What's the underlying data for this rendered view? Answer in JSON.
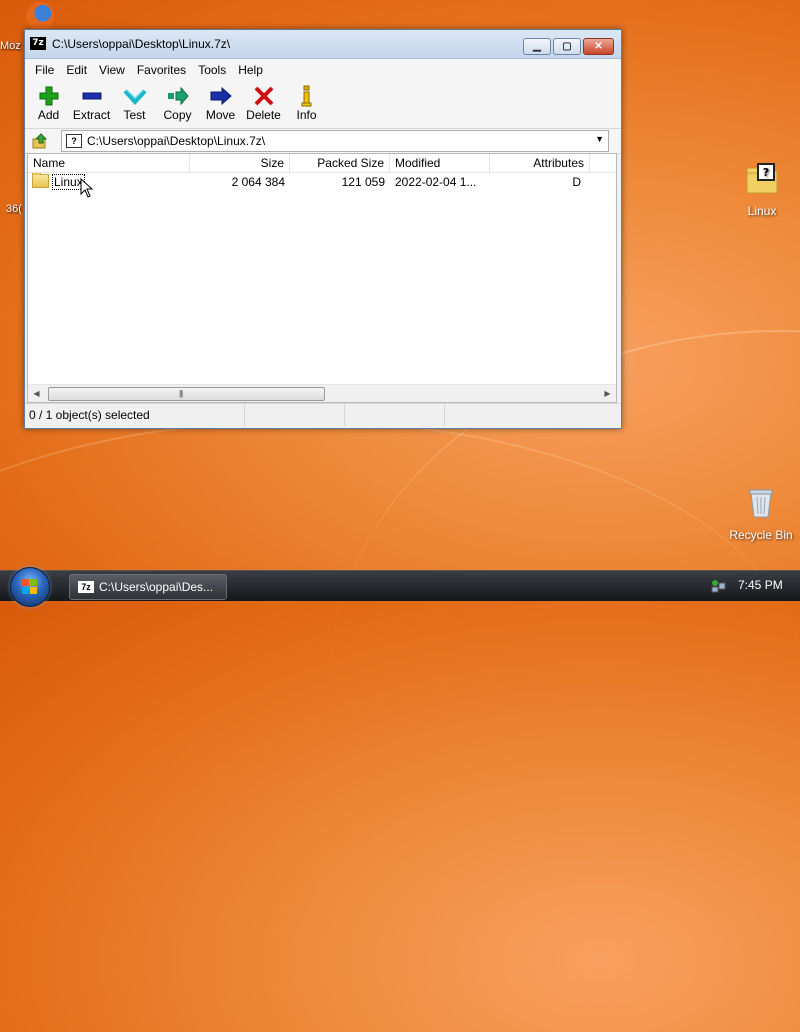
{
  "desktop": {
    "partial_left_label_1": "Moz",
    "partial_left_label_2": "36(",
    "icons": [
      {
        "label": "Linux"
      },
      {
        "label": "Recycle Bin"
      }
    ]
  },
  "window": {
    "title": "C:\\Users\\oppai\\Desktop\\Linux.7z\\",
    "app_icon_text": "7z",
    "menu": [
      "File",
      "Edit",
      "View",
      "Favorites",
      "Tools",
      "Help"
    ],
    "toolbar": [
      {
        "label": "Add",
        "icon": "plus-icon"
      },
      {
        "label": "Extract",
        "icon": "minus-icon"
      },
      {
        "label": "Test",
        "icon": "check-icon"
      },
      {
        "label": "Copy",
        "icon": "copy-arrow-icon"
      },
      {
        "label": "Move",
        "icon": "move-arrow-icon"
      },
      {
        "label": "Delete",
        "icon": "x-icon"
      },
      {
        "label": "Info",
        "icon": "info-icon"
      }
    ],
    "address": "C:\\Users\\oppai\\Desktop\\Linux.7z\\",
    "columns": [
      "Name",
      "Size",
      "Packed Size",
      "Modified",
      "Attributes"
    ],
    "rows": [
      {
        "name": "Linux",
        "size": "2 064 384",
        "packed_size": "121 059",
        "modified": "2022-02-04 1...",
        "attributes": "D"
      }
    ],
    "scroll_grip": "|||",
    "status": "0 / 1 object(s) selected"
  },
  "taskbar": {
    "item_label": "C:\\Users\\oppai\\Des...",
    "clock": "7:45 PM"
  },
  "colors": {
    "desktop_orange": "#e8782a",
    "add_green": "#1aa31a",
    "extract_blue": "#1a2fa8",
    "delete_red": "#d01010"
  }
}
